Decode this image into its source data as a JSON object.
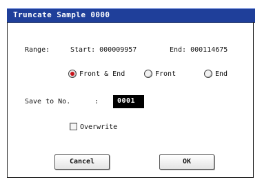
{
  "dialog": {
    "title": "Truncate Sample 0000",
    "range_label": "Range:",
    "start_text": "Start: 000009957",
    "end_text": "End: 000114675",
    "radio_options": [
      {
        "label": "Front & End",
        "selected": true
      },
      {
        "label": "Front",
        "selected": false
      },
      {
        "label": "End",
        "selected": false
      }
    ],
    "save_to_label": "Save to No.",
    "save_to_colon": ":",
    "save_to_value": "0001",
    "overwrite_label": "Overwrite",
    "overwrite_checked": false,
    "cancel_label": "Cancel",
    "ok_label": "OK"
  },
  "colors": {
    "title_bar": "#1f3f9a",
    "radio_selected": "#c8141b",
    "field_bg": "#000000"
  }
}
